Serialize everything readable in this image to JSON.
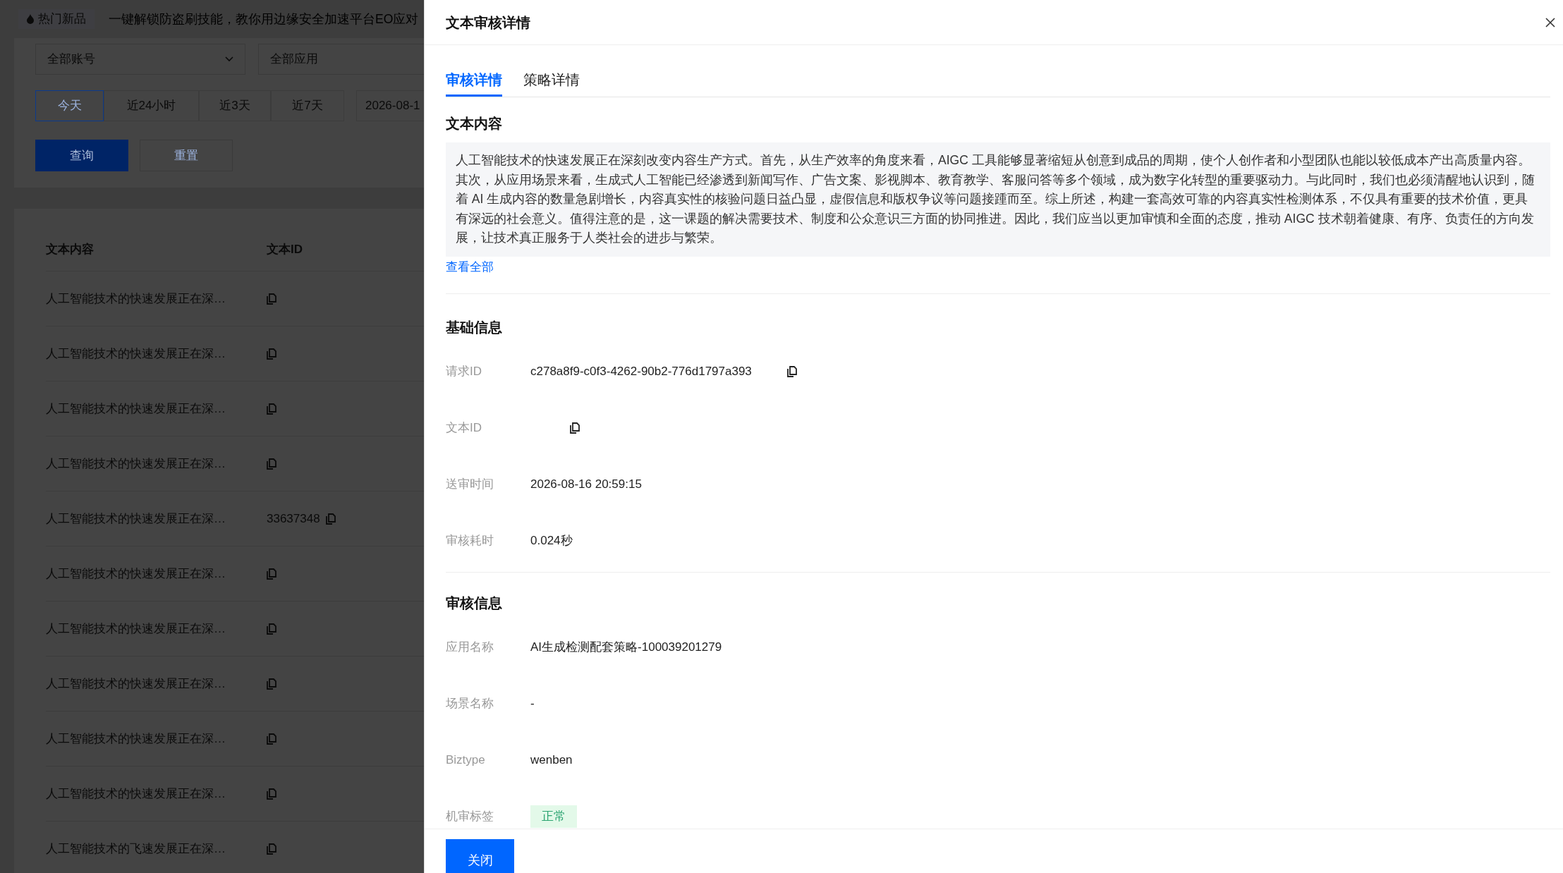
{
  "background_page": {
    "banner": {
      "tag": "热门新品",
      "text": "一键解锁防盗刷技能，教你用边缘安全加速平台EO应对"
    },
    "filters": {
      "account_select": "全部账号",
      "app_select": "全部应用"
    },
    "time_ranges": [
      {
        "label": "今天",
        "selected": true
      },
      {
        "label": "近24小时",
        "selected": false
      },
      {
        "label": "近3天",
        "selected": false
      },
      {
        "label": "近7天",
        "selected": false
      }
    ],
    "date_field": "2026-08-1",
    "buttons": [
      {
        "label": "查询",
        "kind": "primary"
      },
      {
        "label": "重置",
        "kind": "secondary"
      }
    ],
    "table": {
      "columns": [
        "文本内容",
        "文本ID"
      ],
      "rows": [
        {
          "content": "人工智能技术的快速发展正在深…",
          "copyable": true
        },
        {
          "content": "人工智能技术的快速发展正在深…",
          "copyable": true
        },
        {
          "content": "人工智能技术的快速发展正在深…",
          "copyable": true
        },
        {
          "content": "人工智能技术的快速发展正在深…",
          "copyable": true
        },
        {
          "content": "人工智能技术的快速发展正在深…",
          "text_id": "33637348",
          "copyable": true
        },
        {
          "content": "人工智能技术的快速发展正在深…",
          "copyable": true
        },
        {
          "content": "人工智能技术的快速发展正在深…",
          "copyable": true
        },
        {
          "content": "人工智能技术的快速发展正在深…",
          "copyable": true
        },
        {
          "content": "人工智能技术的快速发展正在深…",
          "copyable": true
        },
        {
          "content": "人工智能技术的快速发展正在深…",
          "copyable": true
        },
        {
          "content": "人工智能技术的飞速发展正在深…",
          "copyable": true
        }
      ]
    }
  },
  "drawer": {
    "title": "文本审核详情",
    "tabs": [
      {
        "label": "审核详情",
        "selected": true
      },
      {
        "label": "策略详情",
        "selected": false
      }
    ],
    "text_section": {
      "heading": "文本内容",
      "content": "人工智能技术的快速发展正在深刻改变内容生产方式。首先，从生产效率的角度来看，AIGC 工具能够显著缩短从创意到成品的周期，使个人创作者和小型团队也能以较低成本产出高质量内容。其次，从应用场景来看，生成式人工智能已经渗透到新闻写作、广告文案、影视脚本、教育教学、客服问答等多个领域，成为数字化转型的重要驱动力。与此同时，我们也必须清醒地认识到，随着 AI 生成内容的数量急剧增长，内容真实性的核验问题日益凸显，虚假信息和版权争议等问题接踵而至。综上所述，构建一套高效可靠的内容真实性检测体系，不仅具有重要的技术价值，更具有深远的社会意义。值得注意的是，这一课题的解决需要技术、制度和公众意识三方面的协同推进。因此，我们应当以更加审慎和全面的态度，推动 AIGC 技术朝着健康、有序、负责任的方向发展，让技术真正服务于人类社会的进步与繁荣。",
      "link": "查看全部"
    },
    "sections": [
      {
        "heading": "基础信息",
        "rows": [
          {
            "label": "请求ID",
            "value": "c278a8f9-c0f3-4262-90b2-776d1797a393",
            "copyable": true
          },
          {
            "label": "文本ID",
            "copyable": true
          },
          {
            "label": "送审时间",
            "value": "2026-08-16 20:59:15",
            "copyable": false
          },
          {
            "label": "审核耗时",
            "value": "0.024秒",
            "copyable": false
          }
        ]
      },
      {
        "heading": "审核信息",
        "rows": [
          {
            "label": "应用名称",
            "value": "AI生成检测配套策略-100039201279",
            "copyable": false
          },
          {
            "label": "场景名称",
            "value": "-",
            "copyable": false
          },
          {
            "label": "Biztype",
            "value": "wenben",
            "copyable": false
          },
          {
            "label": "机审标签",
            "value": "正常",
            "kind": "tag",
            "copyable": false
          }
        ]
      }
    ],
    "footer_button": "关闭"
  }
}
